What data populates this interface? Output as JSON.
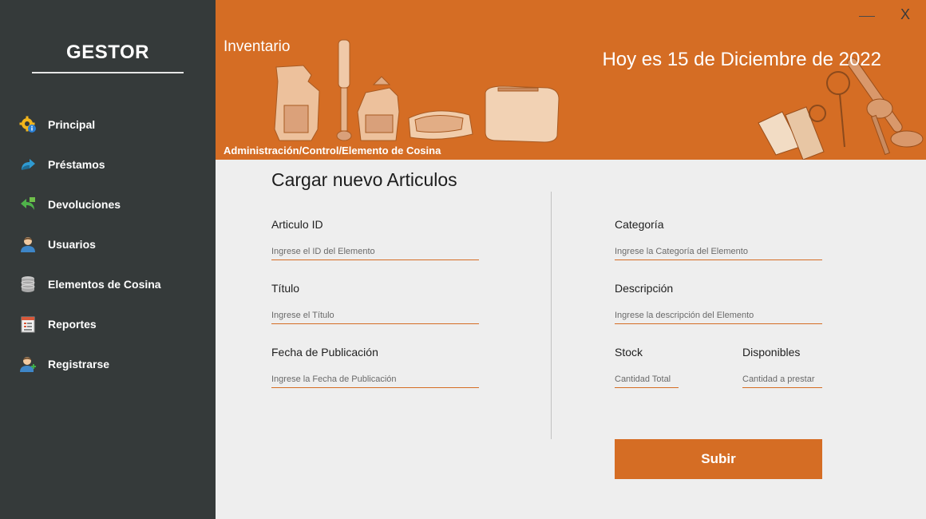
{
  "sidebar": {
    "brand": "GESTOR",
    "items": [
      {
        "label": "Principal",
        "icon": "gear-info-icon"
      },
      {
        "label": "Préstamos",
        "icon": "share-arrow-icon"
      },
      {
        "label": "Devoluciones",
        "icon": "return-arrow-icon"
      },
      {
        "label": "Usuarios",
        "icon": "user-icon"
      },
      {
        "label": "Elementos de Cosina",
        "icon": "database-icon"
      },
      {
        "label": "Reportes",
        "icon": "report-icon"
      },
      {
        "label": "Registrarse",
        "icon": "add-user-icon"
      }
    ]
  },
  "header": {
    "title": "Inventario",
    "date": "Hoy es 15 de Diciembre de 2022",
    "breadcrumb": "Administración/Control/Elemento de Cosina",
    "minimize": "—",
    "close": "X"
  },
  "form": {
    "title": "Cargar nuevo Articulos",
    "fields": {
      "id": {
        "label": "Articulo ID",
        "placeholder": "Ingrese el ID del Elemento"
      },
      "titulo": {
        "label": "Título",
        "placeholder": "Ingrese el Título"
      },
      "fecha": {
        "label": "Fecha de Publicación",
        "placeholder": "Ingrese la Fecha de Publicación"
      },
      "categoria": {
        "label": "Categoría",
        "placeholder": "Ingrese la Categoría del Elemento"
      },
      "descripcion": {
        "label": "Descripción",
        "placeholder": "Ingrese la descripción del Elemento"
      },
      "stock": {
        "label": "Stock",
        "placeholder": "Cantidad Total"
      },
      "disponibles": {
        "label": "Disponibles",
        "placeholder": "Cantidad a prestar"
      }
    },
    "submit": "Subir"
  },
  "colors": {
    "accent": "#d56d24",
    "sidebar": "#353a3a",
    "background": "#eeeeee"
  }
}
